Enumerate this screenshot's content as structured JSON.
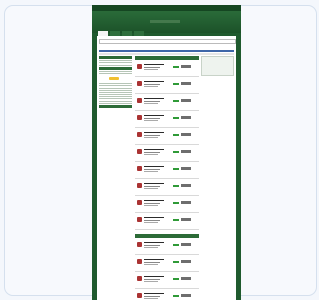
{
  "window": {
    "top_left_text": "",
    "top_right_text": ""
  },
  "site": {
    "logo_text": ""
  },
  "tabs": [
    {
      "label": ""
    },
    {
      "label": ""
    },
    {
      "label": ""
    },
    {
      "label": ""
    }
  ],
  "main": {
    "section_header_1": "",
    "section_header_2": "",
    "items_visible": 14
  },
  "colors": {
    "page_bg": "#1f5a2e",
    "header_bg": "#2a6b39",
    "section_green": "#2c6b37",
    "price_green": "#2f9a37",
    "accent_blue": "#3e66a8",
    "highlight_yellow": "#f0c030"
  },
  "icons": [
    "product-thumb-icon"
  ]
}
